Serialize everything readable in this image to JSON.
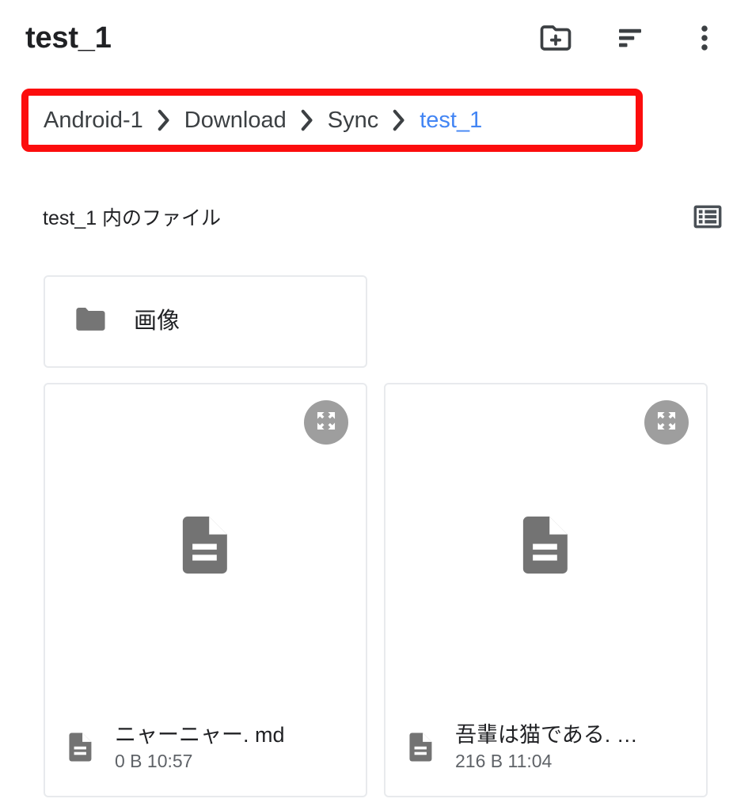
{
  "appbar": {
    "title": "test_1",
    "actions": [
      {
        "name": "create-new-folder-icon",
        "label": "新しいフォルダ"
      },
      {
        "name": "sort-icon",
        "label": "並べ替え"
      },
      {
        "name": "more-vert-icon",
        "label": "その他のオプション"
      }
    ]
  },
  "breadcrumb": {
    "separator": "›",
    "items": [
      {
        "label": "Android-1",
        "current": false
      },
      {
        "label": "Download",
        "current": false
      },
      {
        "label": "Sync",
        "current": false
      },
      {
        "label": "test_1",
        "current": true
      }
    ],
    "highlight_color": "#fc0d0d",
    "current_color": "#4285f4"
  },
  "section": {
    "title": "test_1 内のファイル",
    "view_toggle": {
      "name": "list-view-icon",
      "label": "表示切り替え"
    }
  },
  "folders": [
    {
      "name": "画像",
      "icon": "folder-icon"
    }
  ],
  "files": [
    {
      "name": "ニャーニャー. md",
      "size": "0 B",
      "time": "10:57",
      "meta": "0 B 10:57",
      "icon": "document-icon",
      "expand_icon": "expand-icon"
    },
    {
      "name": "吾輩は猫である. …",
      "size": "216 B",
      "time": "11:04",
      "meta": "216 B 11:04",
      "icon": "document-icon",
      "expand_icon": "expand-icon"
    }
  ],
  "colors": {
    "icon": "#3c4043",
    "doc_gray": "#737373",
    "folder_gray": "#757575",
    "badge_gray": "#9e9e9e",
    "card_border": "#e8eaed",
    "text_primary": "#202124",
    "text_secondary": "#5f6368"
  }
}
